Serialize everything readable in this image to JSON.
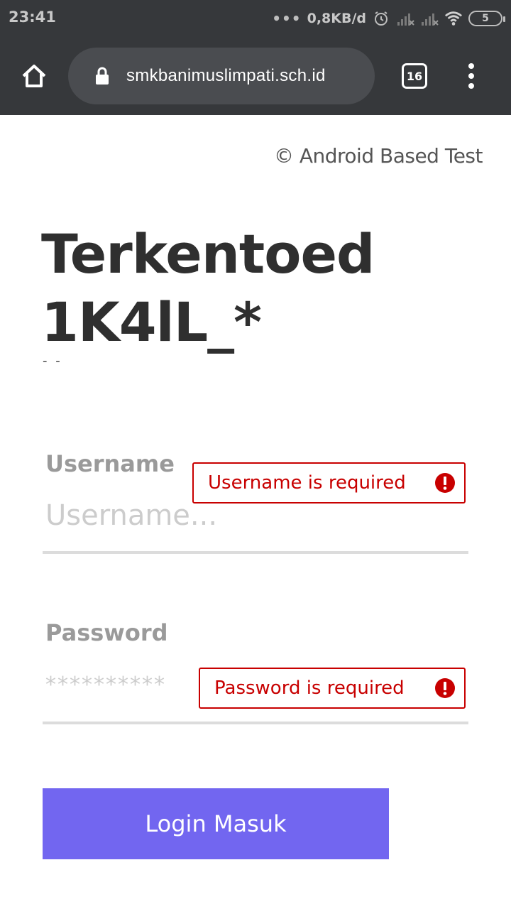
{
  "status_bar": {
    "time": "23:41",
    "dots": "•••",
    "net_speed": "0,8KB/d",
    "battery": "5",
    "icons": [
      "alarm-icon",
      "signal-icon",
      "signal-icon",
      "wifi-icon",
      "battery-icon"
    ]
  },
  "browser": {
    "url": "smkbanimuslimpati.sch.id",
    "tab_count": "16",
    "icons": [
      "home-icon",
      "lock-icon",
      "tabs-icon",
      "more-vert-icon"
    ]
  },
  "page": {
    "copyright": "© Android Based Test",
    "title": "Terkentoed 1K4lL_*",
    "subtitle": "- -",
    "username_label": "Username",
    "username_placeholder": "Username...",
    "username_error": "Username is required",
    "password_label": "Password",
    "password_placeholder": "**********",
    "password_error": "Password is required",
    "login_label": "Login Masuk"
  },
  "colors": {
    "browser_bg": "#36383b",
    "error": "#c80000",
    "button": "#7266f0"
  }
}
